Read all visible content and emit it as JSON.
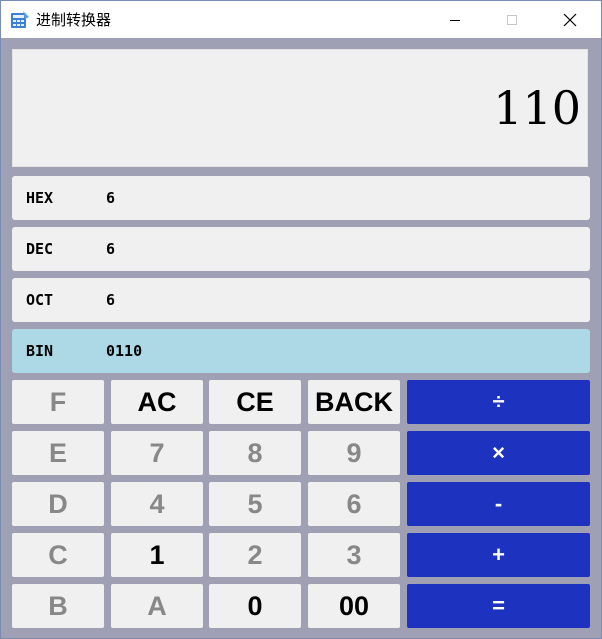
{
  "window": {
    "title": "进制转换器",
    "accent_color": "#1e32c0",
    "active_row_color": "#add8e6"
  },
  "display": {
    "value": "110"
  },
  "bases": [
    {
      "label": "HEX",
      "value": "6",
      "active": false
    },
    {
      "label": "DEC",
      "value": "6",
      "active": false
    },
    {
      "label": "OCT",
      "value": "6",
      "active": false
    },
    {
      "label": "BIN",
      "value": "0110",
      "active": true
    }
  ],
  "keypad": {
    "rows": [
      [
        {
          "label": "F",
          "enabled": false
        },
        {
          "label": "AC",
          "enabled": true
        },
        {
          "label": "CE",
          "enabled": true
        },
        {
          "label": "BACK",
          "enabled": true
        },
        {
          "label": "÷",
          "operator": true
        }
      ],
      [
        {
          "label": "E",
          "enabled": false
        },
        {
          "label": "7",
          "enabled": false
        },
        {
          "label": "8",
          "enabled": false
        },
        {
          "label": "9",
          "enabled": false
        },
        {
          "label": "×",
          "operator": true
        }
      ],
      [
        {
          "label": "D",
          "enabled": false
        },
        {
          "label": "4",
          "enabled": false
        },
        {
          "label": "5",
          "enabled": false
        },
        {
          "label": "6",
          "enabled": false
        },
        {
          "label": "-",
          "operator": true
        }
      ],
      [
        {
          "label": "C",
          "enabled": false
        },
        {
          "label": "1",
          "enabled": true
        },
        {
          "label": "2",
          "enabled": false
        },
        {
          "label": "3",
          "enabled": false
        },
        {
          "label": "+",
          "operator": true
        }
      ],
      [
        {
          "label": "B",
          "enabled": false
        },
        {
          "label": "A",
          "enabled": false
        },
        {
          "label": "0",
          "enabled": true
        },
        {
          "label": "00",
          "enabled": true
        },
        {
          "label": "=",
          "operator": true
        }
      ]
    ]
  }
}
